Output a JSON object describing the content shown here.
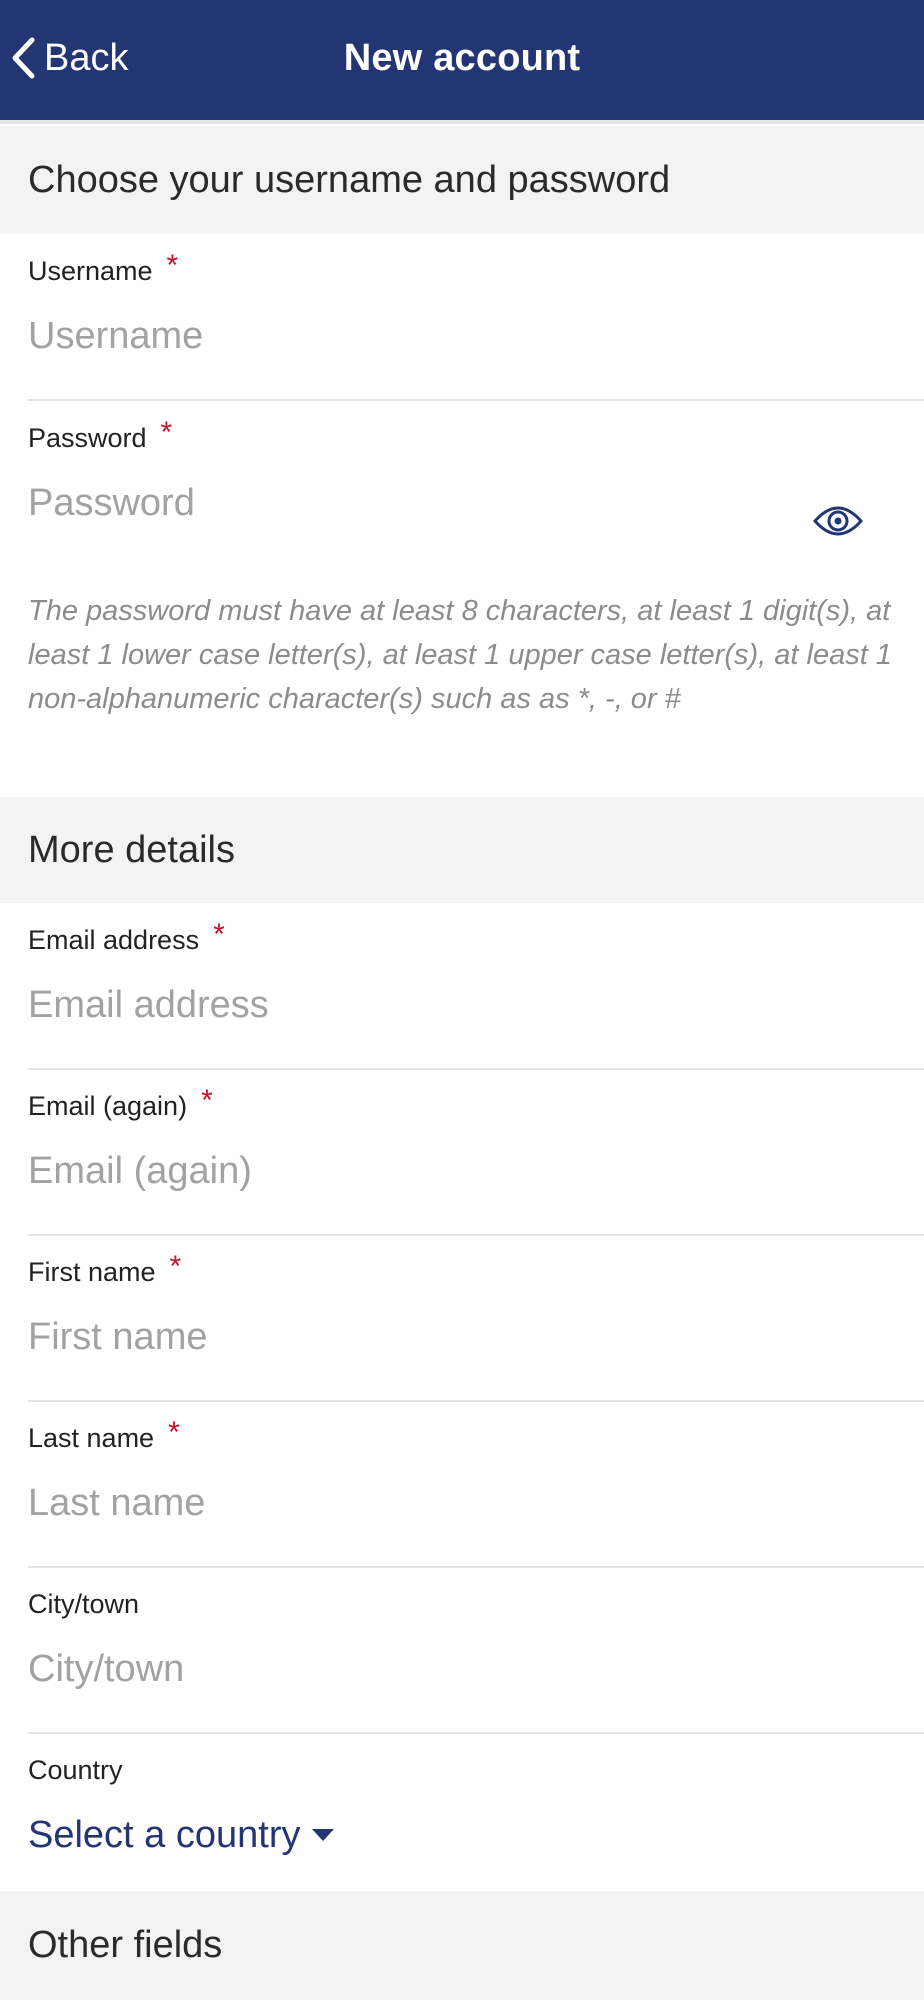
{
  "header": {
    "back_label": "Back",
    "title": "New account",
    "bar_color": "#233572"
  },
  "sections": {
    "credentials": "Choose your username and password",
    "details": "More details",
    "other": "Other fields"
  },
  "fields": {
    "username": {
      "label": "Username",
      "placeholder": "Username",
      "required": "*"
    },
    "password": {
      "label": "Password",
      "placeholder": "Password",
      "required": "*"
    },
    "email": {
      "label": "Email address",
      "placeholder": "Email address",
      "required": "*"
    },
    "email_again": {
      "label": "Email (again)",
      "placeholder": "Email (again)",
      "required": "*"
    },
    "first_name": {
      "label": "First name",
      "placeholder": "First name",
      "required": "*"
    },
    "last_name": {
      "label": "Last name",
      "placeholder": "Last name",
      "required": "*"
    },
    "city": {
      "label": "City/town",
      "placeholder": "City/town"
    },
    "country": {
      "label": "Country",
      "selected": "Select a country"
    }
  },
  "password_hint": "The password must have at least 8 characters, at least 1 digit(s), at least 1 lower case letter(s), at least 1 upper case letter(s), at least 1 non-alphanumeric character(s) such as as *, -, or #",
  "icons": {
    "back": "chevron-left-icon",
    "show_password": "eye-icon",
    "dropdown": "caret-down-icon"
  },
  "colors": {
    "accent": "#233572",
    "required": "#c8102e",
    "section_bg": "#f3f3f3"
  }
}
